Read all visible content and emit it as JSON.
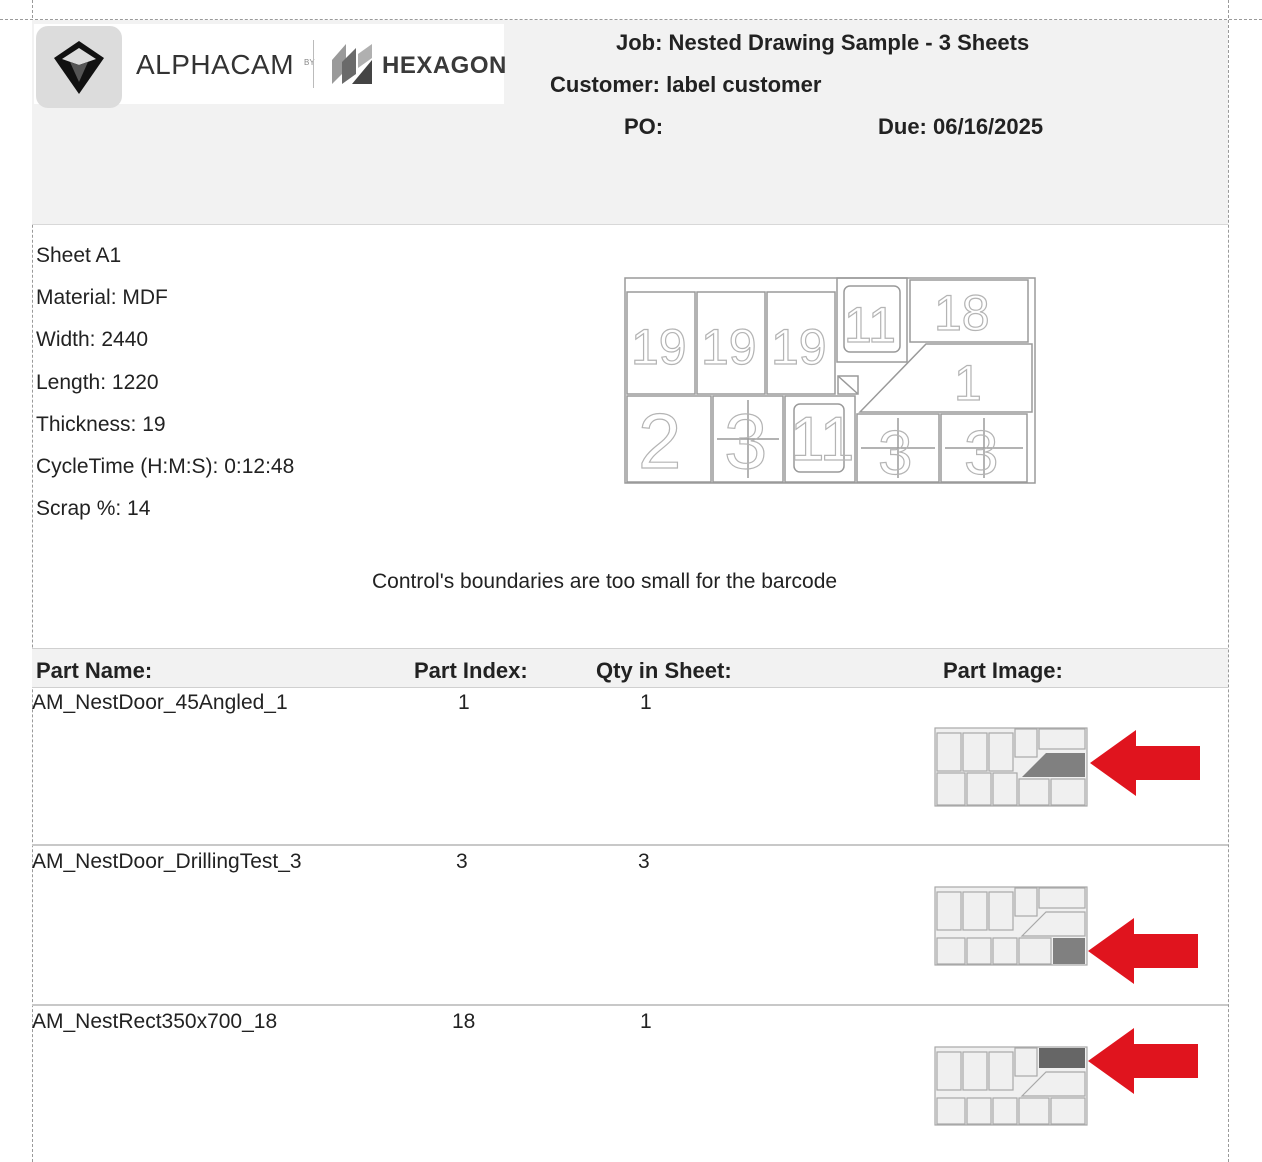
{
  "brand": {
    "name": "ALPHACAM",
    "by": "BY",
    "partner": "HEXAGON"
  },
  "header": {
    "job": "Job: Nested Drawing Sample - 3 Sheets",
    "customer": "Customer: label customer",
    "po": "PO:",
    "due": "Due: 06/16/2025"
  },
  "sheet": {
    "name": "Sheet A1",
    "material": "Material: MDF",
    "width": "Width: 2440",
    "length": "Length: 1220",
    "thickness": "Thickness: 19",
    "cycle_time": "CycleTime (H:M:S): 0:12:48",
    "scrap": "Scrap %: 14"
  },
  "nest_labels": [
    "19",
    "19",
    "19",
    "11",
    "18",
    "1",
    "2",
    "3",
    "11",
    "3",
    "3"
  ],
  "barcode_message": "Control's boundaries are too small for the barcode",
  "table": {
    "headers": [
      "Part Name:",
      "Part Index:",
      "Qty in Sheet:",
      "Part Image:"
    ],
    "rows": [
      {
        "part_name": "AM_NestDoor_45Angled_1",
        "part_index": "1",
        "qty": "1",
        "highlight": "angled-door"
      },
      {
        "part_name": "AM_NestDoor_DrillingTest_3",
        "part_index": "3",
        "qty": "3",
        "highlight": "drilling-test"
      },
      {
        "part_name": "AM_NestRect350x700_18",
        "part_index": "18",
        "qty": "1",
        "highlight": "rect-350x700"
      }
    ]
  },
  "colors": {
    "header_band": "#f2f2f2",
    "arrow": "#e0141e",
    "nest_line": "#9a9a9a",
    "highlight_fill": "#808080"
  },
  "icons": [
    "alphacam-logo-icon",
    "hexagon-logo-icon",
    "red-arrow-icon"
  ]
}
